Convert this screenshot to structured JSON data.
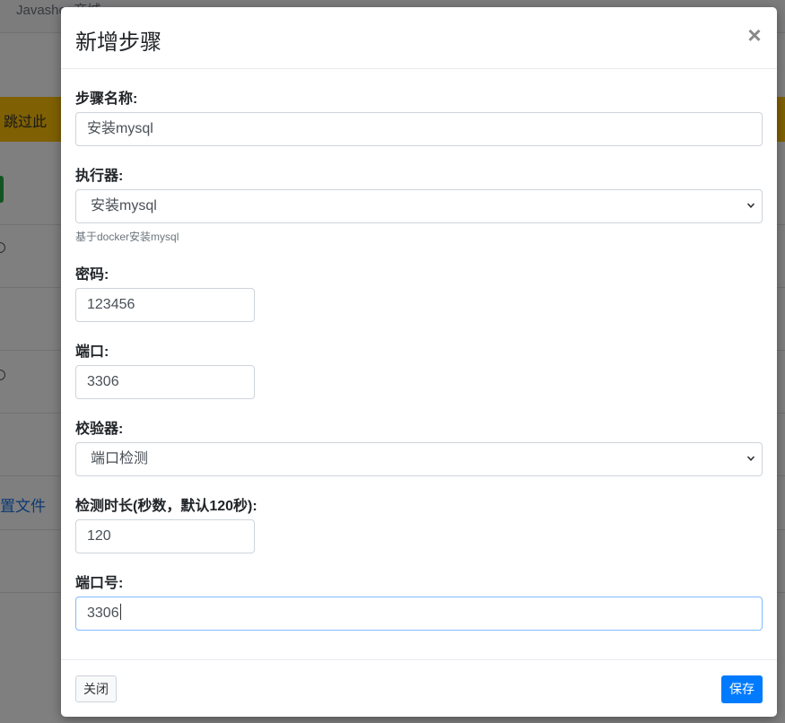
{
  "background": {
    "brand": "Javashop商城",
    "alert_text": "跳过此",
    "link_text": "置文件"
  },
  "modal": {
    "title": "新增步骤",
    "close_icon": "×",
    "fields": {
      "step_name": {
        "label": "步骤名称:",
        "value": "安装mysql"
      },
      "executor": {
        "label": "执行器:",
        "selected": "安装mysql",
        "help": "基于docker安装mysql"
      },
      "password": {
        "label": "密码:",
        "value": "123456"
      },
      "port": {
        "label": "端口:",
        "value": "3306"
      },
      "validator": {
        "label": "校验器:",
        "selected": "端口检测"
      },
      "check_duration": {
        "label": "检测时长(秒数，默认120秒):",
        "value": "120"
      },
      "port_number": {
        "label": "端口号:",
        "value": "3306"
      }
    },
    "footer": {
      "close_label": "关闭",
      "save_label": "保存"
    }
  },
  "colors": {
    "primary": "#007bff",
    "alert": "#ffc107",
    "overlay": "rgba(0,0,0,0.5)"
  }
}
